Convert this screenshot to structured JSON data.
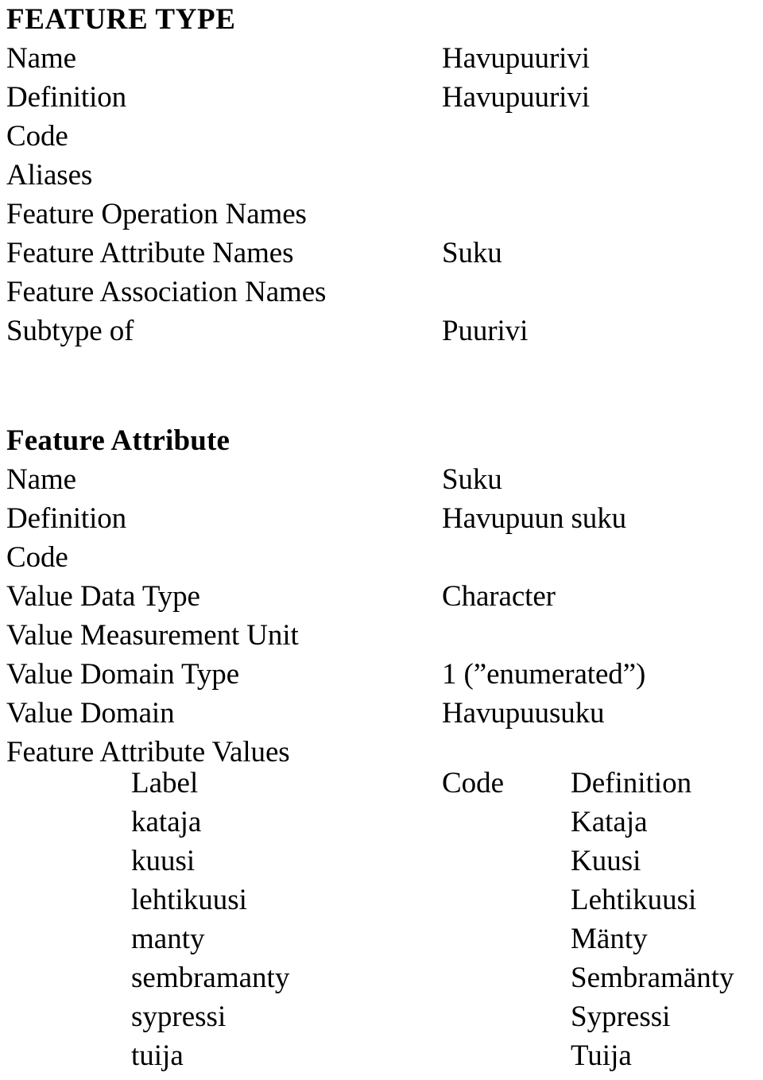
{
  "document": {
    "blocks": [
      {
        "heading": "FEATURE TYPE",
        "heading_style": "caps",
        "rows": [
          {
            "label": "Name",
            "value": "Havupuurivi"
          },
          {
            "label": "Definition",
            "value": "Havupuurivi"
          },
          {
            "label": "Code",
            "value": ""
          },
          {
            "label": "Aliases",
            "value": ""
          },
          {
            "label": "Feature Operation Names",
            "value": ""
          },
          {
            "label": "Feature Attribute Names",
            "value": "Suku"
          },
          {
            "label": "Feature Association Names",
            "value": ""
          },
          {
            "label": "Subtype of",
            "value": "Puurivi"
          }
        ]
      },
      {
        "heading": "Feature Attribute",
        "heading_style": "title",
        "rows": [
          {
            "label": "Name",
            "value": "Suku"
          },
          {
            "label": "Definition",
            "value": "Havupuun suku"
          },
          {
            "label": "Code",
            "value": ""
          },
          {
            "label": "Value Data Type",
            "value": "Character"
          },
          {
            "label": "Value Measurement Unit",
            "value": ""
          },
          {
            "label": "Value Domain Type",
            "value": "1 (”enumerated”)"
          },
          {
            "label": "Value Domain",
            "value": "Havupuusuku"
          },
          {
            "label": "Feature Attribute Values",
            "value": ""
          }
        ]
      }
    ],
    "values_table": {
      "columns": [
        "Label",
        "Code",
        "Definition"
      ],
      "rows": [
        {
          "label": "kataja",
          "code": "",
          "definition": "Kataja"
        },
        {
          "label": "kuusi",
          "code": "",
          "definition": "Kuusi"
        },
        {
          "label": "lehtikuusi",
          "code": "",
          "definition": "Lehtikuusi"
        },
        {
          "label": "manty",
          "code": "",
          "definition": "Mänty"
        },
        {
          "label": "sembramanty",
          "code": "",
          "definition": "Sembramänty"
        },
        {
          "label": "sypressi",
          "code": "",
          "definition": "Sypressi"
        },
        {
          "label": "tuija",
          "code": "",
          "definition": "Tuija"
        }
      ]
    }
  }
}
